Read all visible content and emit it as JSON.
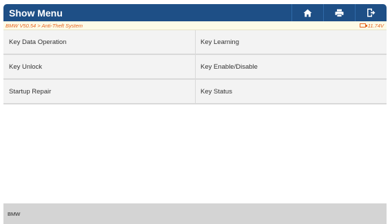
{
  "header": {
    "title": "Show Menu",
    "buttons": [
      {
        "name": "home",
        "icon": "home-icon"
      },
      {
        "name": "print",
        "icon": "printer-icon"
      },
      {
        "name": "exit",
        "icon": "exit-icon"
      }
    ],
    "background_color": "#1e4f86"
  },
  "infobar": {
    "path": "BMW V50.54 > Anti-Theft System",
    "battery_icon": "battery-icon",
    "voltage": "11.74V",
    "text_color": "#e7631e"
  },
  "menu": {
    "rows": [
      {
        "left": "Key Data Operation",
        "right": "Key Learning"
      },
      {
        "left": "Key Unlock",
        "right": "Key Enable/Disable"
      },
      {
        "left": "Startup Repair",
        "right": "Key Status"
      }
    ]
  },
  "footer": {
    "label": "BMW"
  }
}
